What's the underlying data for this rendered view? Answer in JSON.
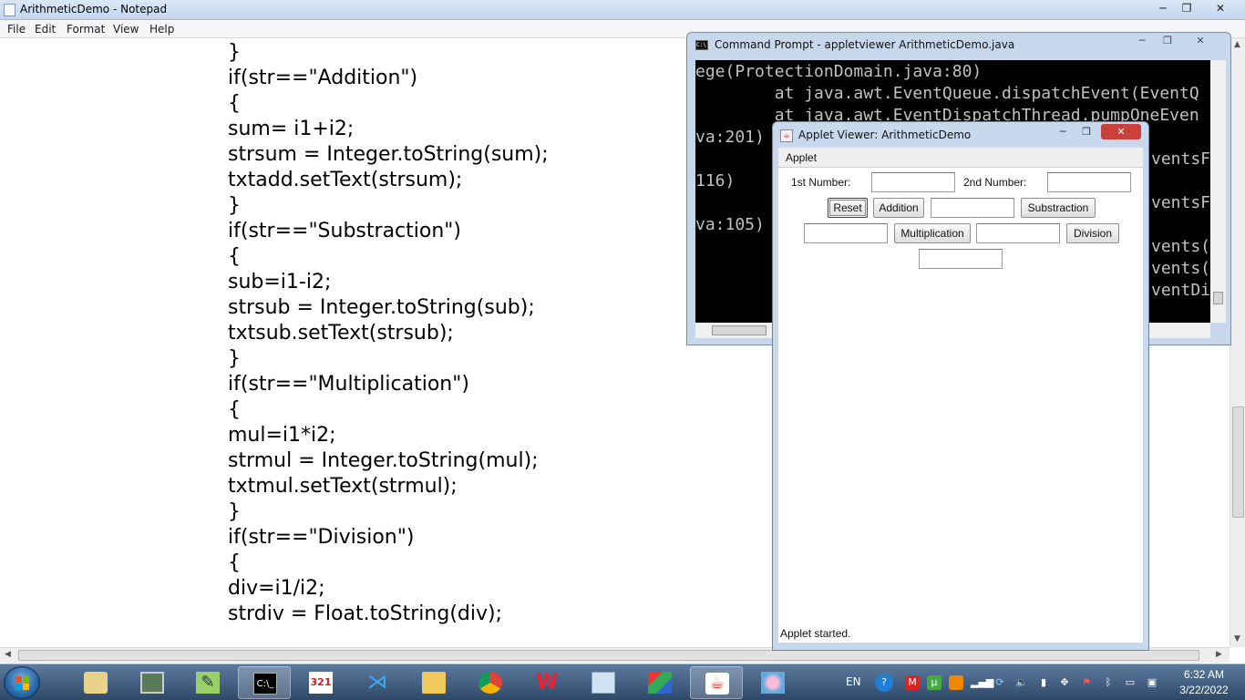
{
  "notepad": {
    "title": "ArithmeticDemo - Notepad",
    "menu": [
      "File",
      "Edit",
      "Format",
      "View",
      "Help"
    ],
    "window_controls": {
      "minimize": "─",
      "maximize": "❐",
      "close": "✕"
    },
    "code_lines": [
      "}",
      "if(str==\"Addition\")",
      "{",
      "sum= i1+i2;",
      "strsum = Integer.toString(sum);",
      "txtadd.setText(strsum);",
      "}",
      "if(str==\"Substraction\")",
      "{",
      "sub=i1-i2;",
      "strsub = Integer.toString(sub);",
      "txtsub.setText(strsub);",
      "}",
      "if(str==\"Multiplication\")",
      "{",
      "mul=i1*i2;",
      "strmul = Integer.toString(mul);",
      "txtmul.setText(strmul);",
      "}",
      "if(str==\"Division\")",
      "{",
      "div=i1/i2;",
      "strdiv = Float.toString(div);"
    ]
  },
  "cmd": {
    "title": "Command Prompt - appletviewer  ArithmeticDemo.java",
    "lines": [
      "ege(ProtectionDomain.java:80)",
      "        at java.awt.EventQueue.dispatchEvent(EventQ",
      "        at java.awt.EventDispatchThread.pumpOneEven",
      "va:201)",
      "116)",
      "va:105)"
    ],
    "right_fragments": [
      "ventsF",
      "ventsF",
      "vents(",
      "vents(",
      "ventDi"
    ]
  },
  "applet": {
    "title": "Applet Viewer: ArithmeticDemo",
    "menu_label": "Applet",
    "label_first": "1st Number:",
    "label_second": "2nd Number:",
    "btn_reset": "Reset",
    "btn_addition": "Addition",
    "btn_substraction": "Substraction",
    "btn_multiplication": "Multiplication",
    "btn_division": "Division",
    "status": "Applet started."
  },
  "taskbar": {
    "language": "EN",
    "time": "6:32 AM",
    "date": "3/22/2022",
    "apps": [
      "file-explorer-icon",
      "computer-icon",
      "notepad-plus-icon",
      "command-prompt-icon",
      "calendar-321-icon",
      "vscode-icon",
      "folder-icon",
      "chrome-icon",
      "wps-office-icon",
      "notepad-icon",
      "virtualbox-icon",
      "java-icon",
      "paint-icon"
    ],
    "calendar_badge": "321"
  },
  "colors": {
    "taskbar": "#2f4868",
    "console_bg": "#000000",
    "console_text": "#c0c0c0",
    "applet_close": "#c9413a"
  }
}
